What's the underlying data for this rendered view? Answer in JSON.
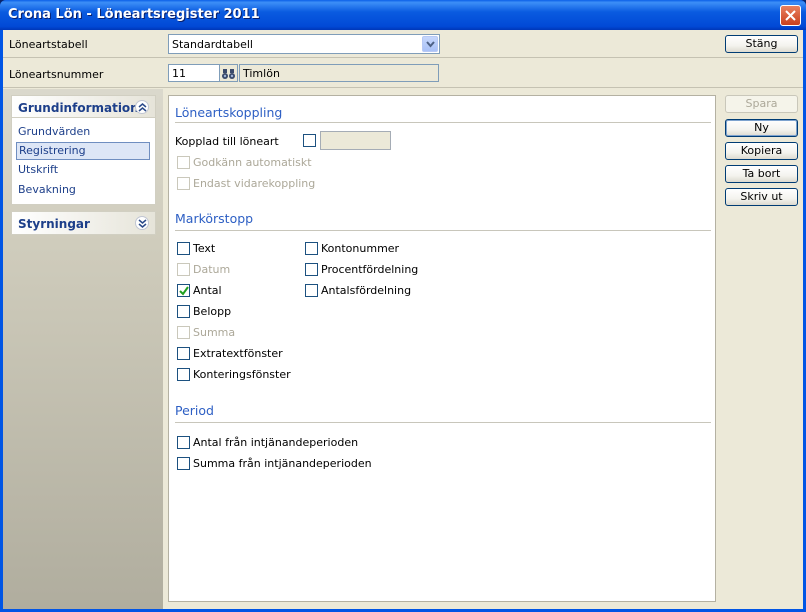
{
  "window": {
    "title": "Crona Lön - Löneartsregister 2011"
  },
  "header": {
    "tabell_label": "Löneartstabell",
    "tabell_value": "Standardtabell",
    "nummer_label": "Löneartsnummer",
    "nummer_value": "11",
    "nummer_name": "Timlön"
  },
  "buttons": {
    "stang": "Stäng",
    "spara": "Spara",
    "ny": "Ny",
    "kopiera": "Kopiera",
    "ta_bort": "Ta bort",
    "skriv_ut": "Skriv ut"
  },
  "sidebar": {
    "grund_title": "Grundinformation",
    "items": [
      "Grundvärden",
      "Registrering",
      "Utskrift",
      "Bevakning"
    ],
    "selected_item": "Registrering",
    "styr_title": "Styrningar"
  },
  "main": {
    "koppling_title": "Löneartskoppling",
    "kopplad_label": "Kopplad till löneart",
    "kopplad_value": "",
    "godkann_label": "Godkänn automatiskt",
    "endast_label": "Endast vidarekoppling",
    "markor_title": "Markörstopp",
    "markor_left": [
      {
        "label": "Text",
        "checked": false,
        "enabled": true
      },
      {
        "label": "Datum",
        "checked": false,
        "enabled": false
      },
      {
        "label": "Antal",
        "checked": true,
        "enabled": true
      },
      {
        "label": "Belopp",
        "checked": false,
        "enabled": true
      },
      {
        "label": "Summa",
        "checked": false,
        "enabled": false
      },
      {
        "label": "Extratextfönster",
        "checked": false,
        "enabled": true
      },
      {
        "label": "Konteringsfönster",
        "checked": false,
        "enabled": true
      }
    ],
    "markor_right": [
      {
        "label": "Kontonummer",
        "checked": false,
        "enabled": true
      },
      {
        "label": "Procentfördelning",
        "checked": false,
        "enabled": true
      },
      {
        "label": "Antalsfördelning",
        "checked": false,
        "enabled": true
      }
    ],
    "period_title": "Period",
    "period": [
      {
        "label": "Antal från intjänandeperioden",
        "checked": false
      },
      {
        "label": "Summa från intjänandeperioden",
        "checked": false
      }
    ]
  },
  "colors": {
    "accent": "#2d5fc4",
    "title_bar": "#0055e5",
    "panel_text": "#1d3f8a"
  }
}
